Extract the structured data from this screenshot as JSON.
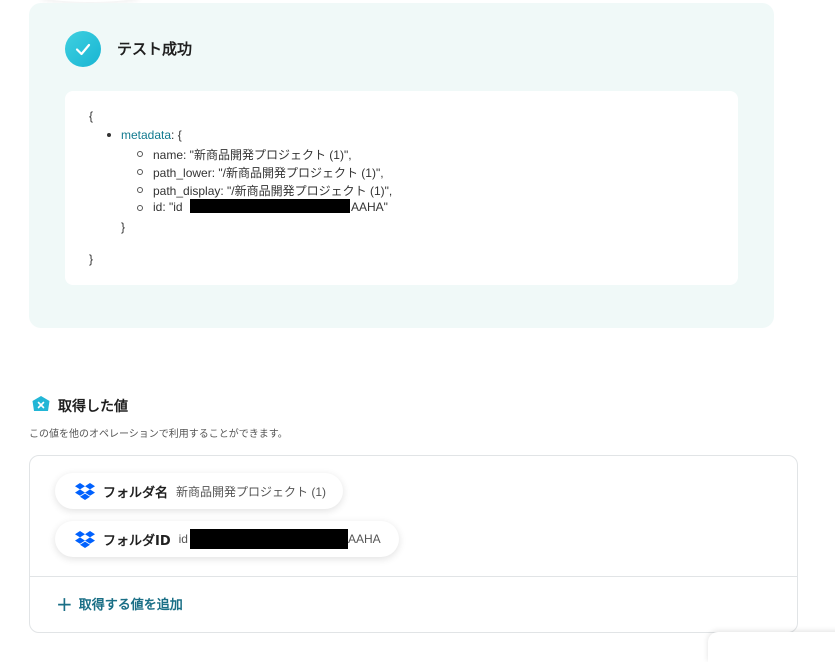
{
  "test_result": {
    "title": "テスト成功",
    "json_lines": {
      "open_brace": "{",
      "metadata_key": "metadata",
      "metadata_open": ": {",
      "name": "name: \"新商品開発プロジェクト (1)\",",
      "path_lower": "path_lower: \"/新商品開発プロジェクト (1)\",",
      "path_display": "path_display: \"/新商品開発プロジェクト (1)\",",
      "id_prefix": "id: \"id",
      "id_suffix": "AAHA\"",
      "inner_close": "}",
      "outer_close": "}"
    }
  },
  "acquired_values": {
    "title": "取得した値",
    "description": "この値を他のオペレーションで利用することができます。",
    "items": [
      {
        "label": "フォルダ名",
        "value": "新商品開発プロジェクト (1)",
        "icon": "dropbox-icon"
      },
      {
        "label": "フォルダID",
        "value_prefix": "id",
        "value_suffix": "AAHA",
        "icon": "dropbox-icon"
      }
    ],
    "add_label": "取得する値を追加"
  },
  "colors": {
    "panel_bg": "#f0f9f8",
    "accent": "#18b5d3",
    "link": "#1a6f86",
    "dropbox": "#0061fe"
  }
}
